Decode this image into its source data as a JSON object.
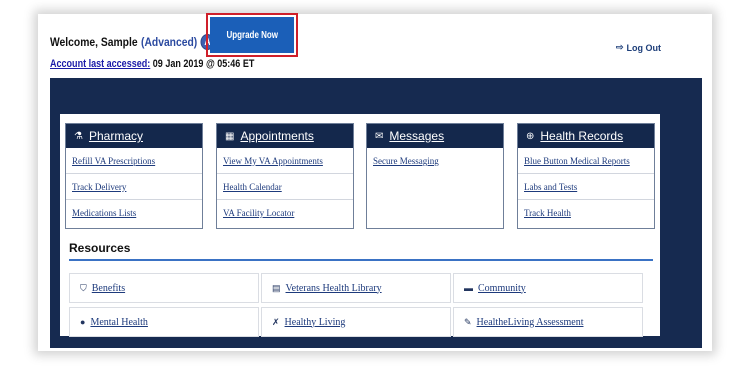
{
  "header": {
    "welcome_prefix": "Welcome, Sample",
    "account_level": "(Advanced)",
    "avatar_letter": "A",
    "upgrade_label": "Upgrade Now",
    "account_label": "Account last accessed:",
    "account_value": "09 Jan 2019 @ 05:46 ET",
    "logout_label": "Log Out"
  },
  "cards": [
    {
      "title": "Pharmacy",
      "icon": "pharmacy-icon",
      "links": [
        "Refill VA Prescriptions",
        "Track Delivery",
        "Medications Lists"
      ]
    },
    {
      "title": "Appointments",
      "icon": "calendar-icon",
      "links": [
        "View My VA Appointments",
        "Health Calendar",
        "VA Facility Locator"
      ]
    },
    {
      "title": "Messages",
      "icon": "message-icon",
      "links": [
        "Secure Messaging"
      ]
    },
    {
      "title": "Health Records",
      "icon": "health-records-icon",
      "links": [
        "Blue Button Medical Reports",
        "Labs and Tests",
        "Track Health"
      ]
    }
  ],
  "resources": {
    "title": "Resources",
    "items": [
      {
        "label": "Benefits",
        "icon": "benefits-icon"
      },
      {
        "label": "Veterans Health Library",
        "icon": "library-icon"
      },
      {
        "label": "Community",
        "icon": "community-icon"
      },
      {
        "label": "Mental Health",
        "icon": "location-icon"
      },
      {
        "label": "Healthy Living",
        "icon": "running-icon"
      },
      {
        "label": "HealtheLiving Assessment",
        "icon": "assessment-icon"
      }
    ]
  },
  "colors": {
    "navy": "#162a50",
    "card_header": "#14284c",
    "upgrade_button": "#1b5fb8",
    "highlight_outline": "#cf1f2a",
    "link": "#1d3a7c",
    "resources_rule": "#3a72c4"
  }
}
